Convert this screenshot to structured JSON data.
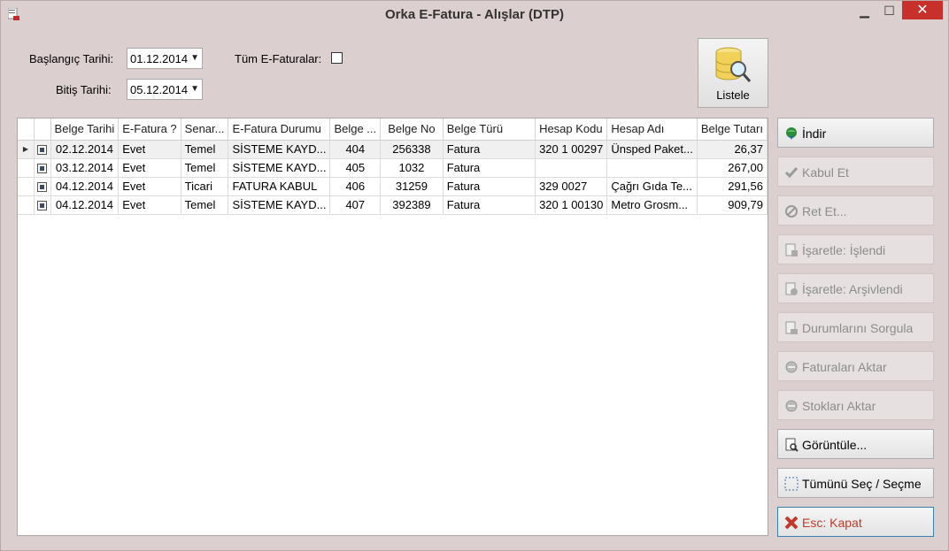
{
  "window": {
    "title": "Orka E-Fatura - Alışlar (DTP)"
  },
  "filters": {
    "start_label": "Başlangıç Tarihi:",
    "start_value": "01.12.2014",
    "end_label": "Bitiş Tarihi:",
    "end_value": "05.12.2014",
    "all_label": "Tüm E-Faturalar:",
    "all_checked": false
  },
  "list_button": {
    "label": "Listele",
    "icon": "database-search-icon"
  },
  "grid": {
    "columns": [
      "Belge Tarihi",
      "E-Fatura ?",
      "Senar...",
      "E-Fatura Durumu",
      "Belge ...",
      "Belge No",
      "Belge Türü",
      "Hesap Kodu",
      "Hesap Adı",
      "Belge Tutarı"
    ],
    "rows": [
      [
        "02.12.2014",
        "Evet",
        "Temel",
        "SİSTEME KAYD...",
        "404",
        "256338",
        "Fatura",
        "320 1 00297",
        "Ünsped Paket...",
        "26,37"
      ],
      [
        "03.12.2014",
        "Evet",
        "Temel",
        "SİSTEME KAYD...",
        "405",
        "1032",
        "Fatura",
        "",
        "",
        "267,00"
      ],
      [
        "04.12.2014",
        "Evet",
        "Ticari",
        "FATURA KABUL",
        "406",
        "31259",
        "Fatura",
        "329 0027",
        "Çağrı Gıda Te...",
        "291,56"
      ],
      [
        "04.12.2014",
        "Evet",
        "Temel",
        "SİSTEME KAYD...",
        "407",
        "392389",
        "Fatura",
        "320 1 00130",
        "Metro Grosm...",
        "909,79"
      ]
    ],
    "selected_row": 0
  },
  "actions": [
    {
      "label": "İndir",
      "icon": "globe-download-icon",
      "enabled": true
    },
    {
      "label": "Kabul Et",
      "icon": "checkmark-icon",
      "enabled": false
    },
    {
      "label": "Ret Et...",
      "icon": "cancel-circle-icon",
      "enabled": false
    },
    {
      "label": "İşaretle: İşlendi",
      "icon": "document-mark-icon",
      "enabled": false
    },
    {
      "label": "İşaretle: Arşivlendi",
      "icon": "document-archive-icon",
      "enabled": false
    },
    {
      "label": "Durumlarını Sorgula",
      "icon": "document-query-icon",
      "enabled": false
    },
    {
      "label": "Faturaları Aktar",
      "icon": "transfer-icon",
      "enabled": false
    },
    {
      "label": "Stokları Aktar",
      "icon": "transfer-icon",
      "enabled": false
    },
    {
      "label": "Görüntüle...",
      "icon": "document-view-icon",
      "enabled": true
    },
    {
      "label": "Tümünü Seç / Seçme",
      "icon": "select-all-icon",
      "enabled": true
    },
    {
      "label": "Esc: Kapat",
      "icon": "close-x-icon",
      "enabled": true,
      "color": "#c0392b"
    }
  ],
  "colors": {
    "window_bg": "#dccfcf",
    "close_button": "#c7302b",
    "kapat_text": "#c0392b"
  }
}
